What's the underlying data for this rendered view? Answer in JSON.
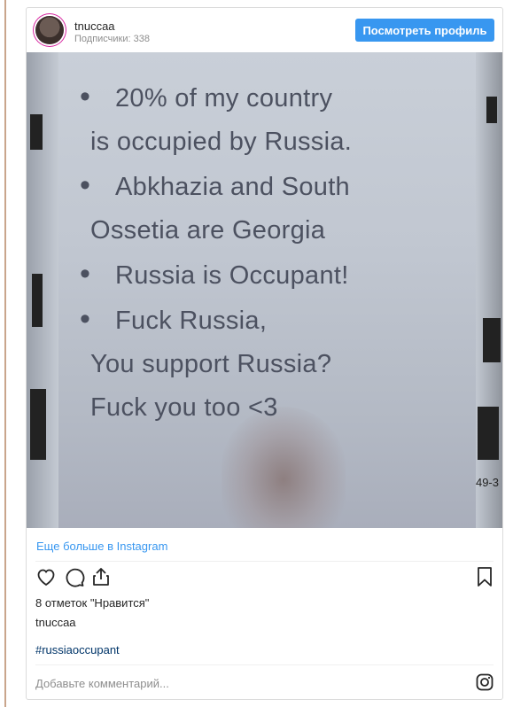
{
  "post": {
    "username": "tnuccaa",
    "followers": "Подписчики: 338",
    "profile_button": "Посмотреть профиль",
    "photo_text": {
      "lines": [
        {
          "bullet": true,
          "text": "20% of my country"
        },
        {
          "bullet": false,
          "text": "is occupied by Russia."
        },
        {
          "bullet": true,
          "text": "Abkhazia and South"
        },
        {
          "bullet": false,
          "text": "Ossetia are Georgia"
        },
        {
          "bullet": true,
          "text": "Russia is Occupant!"
        },
        {
          "bullet": true,
          "text": "Fuck Russia,"
        },
        {
          "bullet": false,
          "text": "You support Russia?"
        },
        {
          "bullet": false,
          "text": "Fuck you too <3"
        }
      ],
      "corner": "49-3"
    },
    "more_link": "Еще больше в Instagram",
    "likes": "8 отметок \"Нравится\"",
    "caption_user": "tnuccaa",
    "hashtag": "#russiaoccupant",
    "comment_placeholder": "Добавьте комментарий..."
  },
  "icons": [
    "heart-icon",
    "comment-icon",
    "share-icon",
    "bookmark-icon",
    "instagram-icon"
  ],
  "colors": {
    "accent": "#3897f0",
    "hashtag": "#003569",
    "muted": "#8e8e8e"
  }
}
